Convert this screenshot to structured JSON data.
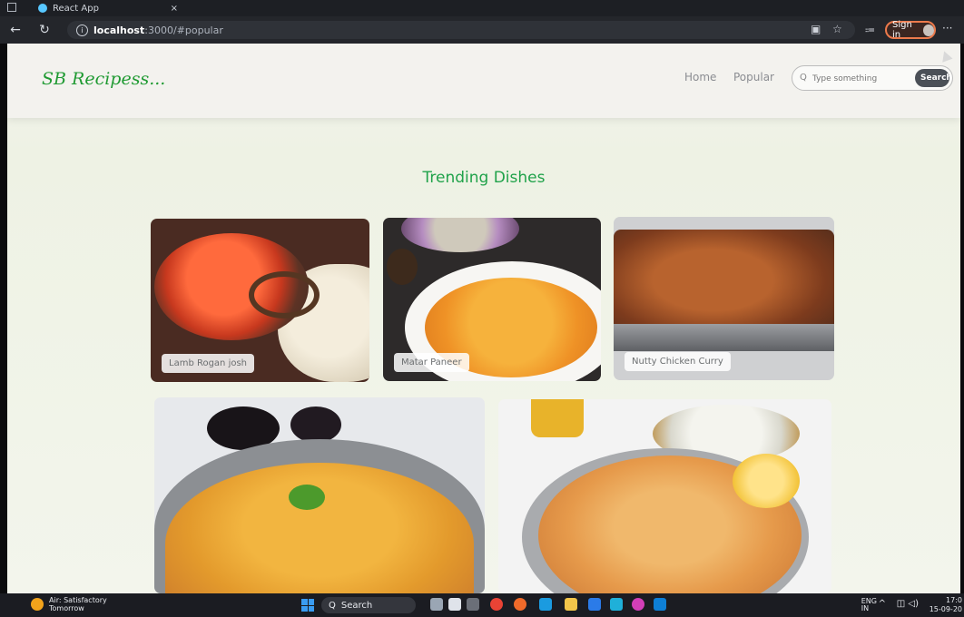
{
  "browser": {
    "tab_title": "React App",
    "tab_close": "×",
    "url_host": "localhost",
    "url_rest": ":3000/#popular",
    "signin_label": "Sign in",
    "more_label": "···"
  },
  "navbar": {
    "logo": "SB Recipess...",
    "links": [
      "Home",
      "Popular"
    ],
    "search_placeholder": "Type something",
    "search_button": "Search"
  },
  "main": {
    "heading": "Trending Dishes",
    "cards": [
      {
        "label": "Lamb Rogan josh"
      },
      {
        "label": "Matar Paneer"
      },
      {
        "label": "Nutty Chicken Curry"
      },
      {
        "label": ""
      },
      {
        "label": ""
      }
    ]
  },
  "taskbar": {
    "weather_line1": "Air: Satisfactory",
    "weather_line2": "Tomorrow",
    "search_label": "Search",
    "lang_line1": "ENG",
    "lang_line2": "IN",
    "time": "17:0",
    "date": "15-09-20"
  },
  "icons": [
    "back-arrow-icon",
    "reload-icon",
    "info-icon",
    "reader-icon",
    "favorite-star-icon",
    "collections-icon",
    "search-icon",
    "windows-start-icon"
  ]
}
